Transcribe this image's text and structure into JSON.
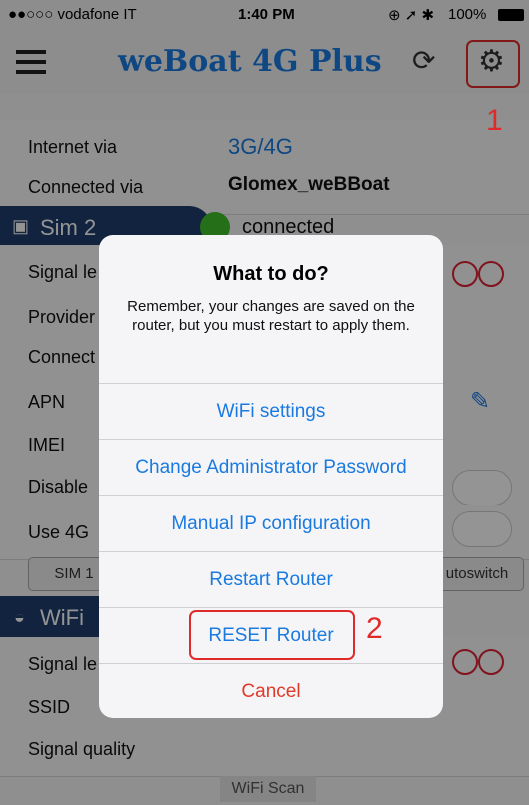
{
  "status_bar": {
    "carrier": "●●○○○ vodafone IT",
    "time": "1:40 PM",
    "battery": "100%"
  },
  "app_bar": {
    "title": "weBoat 4G Plus"
  },
  "background": {
    "internet_via_label": "Internet via",
    "internet_via_value": "3G/4G",
    "connected_via_label": "Connected via",
    "connected_via_value": "Glomex_weBBoat",
    "sim_section": "Sim 2",
    "sim_status": "connected",
    "signal_label": "Signal le",
    "provider_label": "Provider",
    "connect_label": "Connect",
    "apn_label": "APN",
    "imei_label": "IMEI",
    "disable_label": "Disable",
    "use4g_label": "Use 4G",
    "sim1_button": "SIM 1",
    "autoswitch_button": "utoswitch",
    "wifi_section": "WiFi",
    "wifi_signal_label": "Signal le",
    "ssid_label": "SSID",
    "signal_quality_label": "Signal quality",
    "wifi_scan_button": "WiFi Scan"
  },
  "dialog": {
    "title": "What to do?",
    "message": "Remember, your changes are saved on the router, but you must restart to apply them.",
    "buttons": [
      "WiFi settings",
      "Change Administrator Password",
      "Manual IP configuration",
      "Restart Router",
      "RESET Router",
      "Cancel"
    ]
  },
  "callouts": {
    "one": "1",
    "two": "2"
  },
  "colors": {
    "link": "#1a7ae0",
    "cancel": "#e03a2a",
    "callout": "#e02a2a",
    "section": "#1e3d6b"
  }
}
